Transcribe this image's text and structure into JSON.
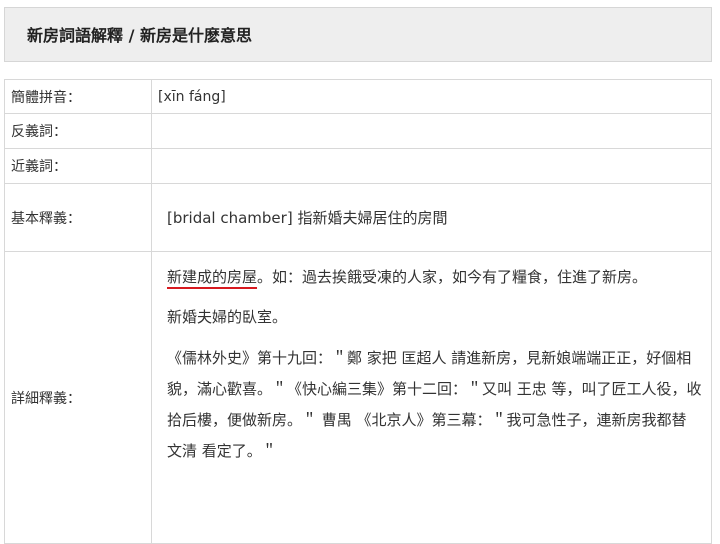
{
  "header": {
    "title": "新房詞語解釋 / 新房是什麽意思"
  },
  "rows": {
    "pinyin": {
      "label": "簡體拼音：",
      "value": "[xīn fáng]"
    },
    "antonym": {
      "label": "反義詞：",
      "value": ""
    },
    "synonym": {
      "label": "近義詞：",
      "value": ""
    },
    "basic": {
      "label": "基本釋義：",
      "value": "[bridal chamber] 指新婚夫婦居住的房間"
    },
    "detail": {
      "label": "詳細釋義：",
      "p1_highlight": "新建成的房屋",
      "p1_rest": "。如：過去挨餓受凍的人家，如今有了糧食，住進了新房。",
      "p2": "新婚夫婦的臥室。",
      "p3": "《儒林外史》第十九回：＂鄭 家把 匡超人 請進新房，見新娘端端正正，好個相貌，滿心歡喜。＂《快心編三集》第十二回：＂又叫 王忠 等，叫了匠工人役，收拾后樓，便做新房。＂ 曹禺 《北京人》第三幕：＂我可急性子，連新房我都替 文清 看定了。＂"
    }
  },
  "colors": {
    "highlight_underline": "#d7191f"
  }
}
